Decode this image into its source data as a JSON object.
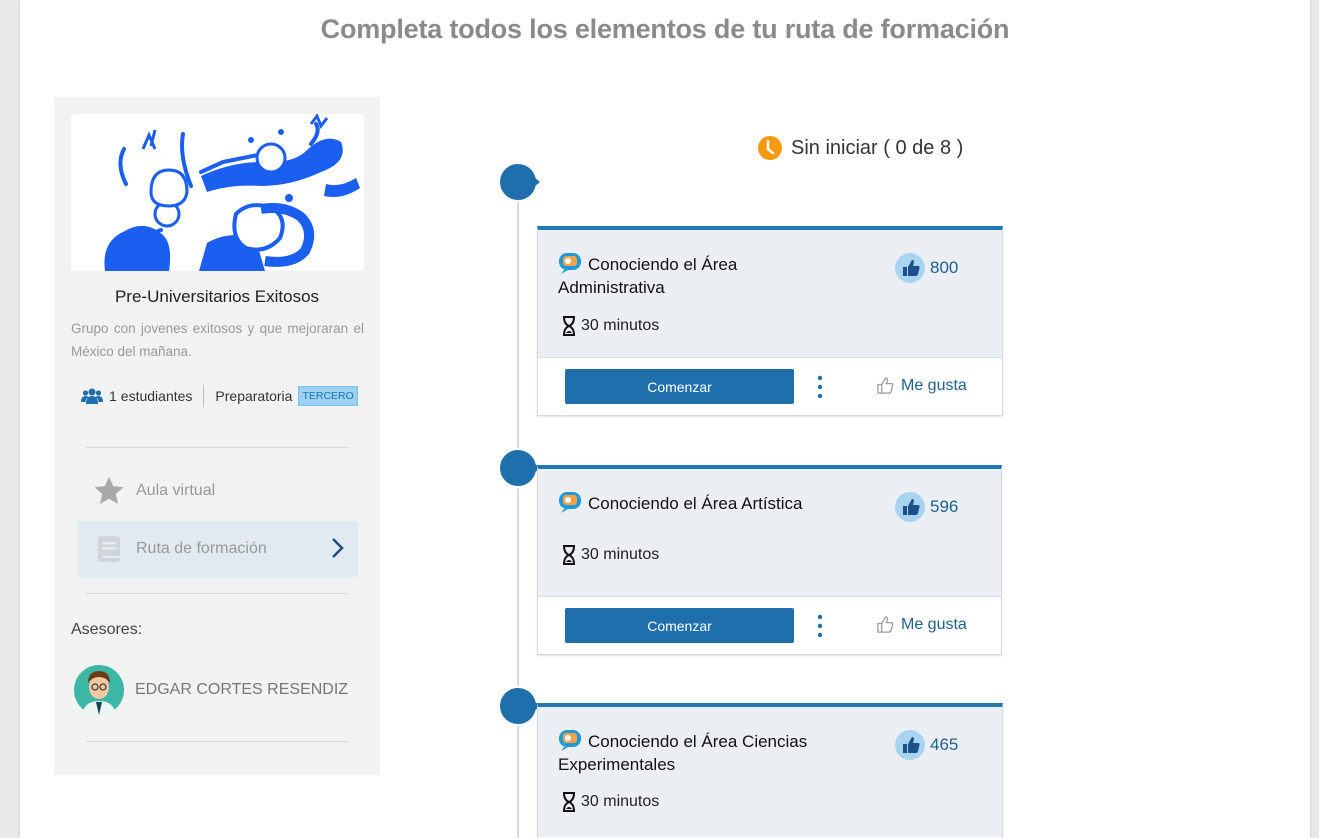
{
  "page": {
    "title": "Completa todos los elementos de tu ruta de formación"
  },
  "sidebar": {
    "group_name": "Pre-Universitarios Exitosos",
    "group_description": "Grupo con jovenes exitosos y que mejoraran el México del mañana.",
    "students_count": "1",
    "students_label": "estudiantes",
    "level": "Preparatoria",
    "grade_badge": "TERCERO",
    "nav": [
      {
        "label": "Aula virtual",
        "icon": "star-icon"
      },
      {
        "label": "Ruta de formación",
        "icon": "book-icon"
      }
    ],
    "advisors_label": "Asesores:",
    "advisor_name": "EDGAR CORTES RESENDIZ"
  },
  "status": {
    "text": "Sin iniciar ( 0 de 8 )",
    "icon": "clock-icon",
    "color": "#f59a0c"
  },
  "cards": [
    {
      "title_line1": "Conociendo el Área",
      "title_line2": "Administrativa",
      "likes": "800",
      "duration": "30 minutos",
      "start_label": "Comenzar",
      "like_label": "Me gusta"
    },
    {
      "title_line1": "Conociendo el Área Artística",
      "title_line2": "",
      "likes": "596",
      "duration": "30 minutos",
      "start_label": "Comenzar",
      "like_label": "Me gusta"
    },
    {
      "title_line1": "Conociendo el Área Ciencias",
      "title_line2": "Experimentales",
      "likes": "465",
      "duration": "30 minutos",
      "start_label": "Comenzar",
      "like_label": "Me gusta"
    }
  ],
  "colors": {
    "accent": "#1f78b4",
    "button": "#1f6fad",
    "badge_bg": "#9bd2f2"
  }
}
